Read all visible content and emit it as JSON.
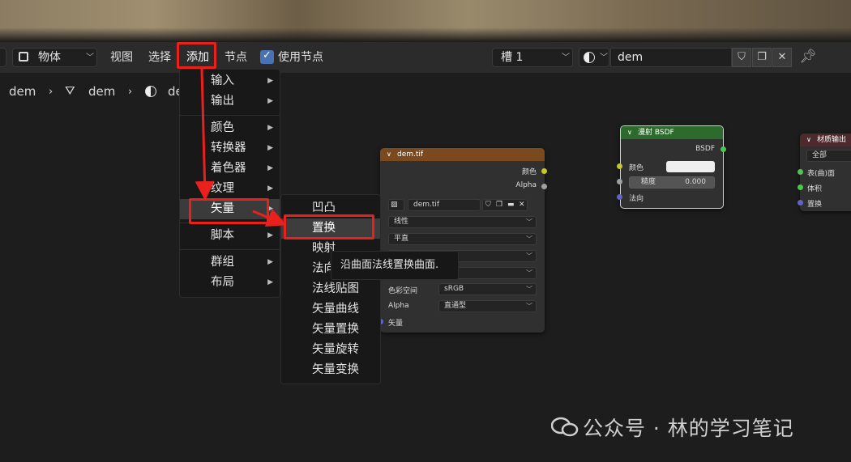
{
  "header": {
    "mode_select": "物体",
    "menus": [
      "视图",
      "选择",
      "添加",
      "节点"
    ],
    "use_nodes_label": "使用节点",
    "use_nodes_checked": true,
    "slot_select": "槽 1",
    "material_name": "dem"
  },
  "breadcrumb": [
    "dem",
    "dem",
    "dem"
  ],
  "add_menu": {
    "items": [
      {
        "label": "输入",
        "submenu": true
      },
      {
        "label": "输出",
        "submenu": true
      },
      {
        "label": "颜色",
        "submenu": true
      },
      {
        "label": "转换器",
        "submenu": true
      },
      {
        "label": "着色器",
        "submenu": true
      },
      {
        "label": "纹理",
        "submenu": true
      },
      {
        "label": "矢量",
        "submenu": true,
        "active": true
      },
      {
        "label": "脚本",
        "submenu": true
      },
      {
        "label": "群组",
        "submenu": true
      },
      {
        "label": "布局",
        "submenu": true
      }
    ]
  },
  "vector_submenu": {
    "items": [
      "凹凸",
      "置换",
      "映射",
      "法向",
      "法线贴图",
      "矢量曲线",
      "矢量置换",
      "矢量旋转",
      "矢量变换"
    ],
    "highlighted": "置换"
  },
  "tooltip": "沿曲面法线置换曲面.",
  "image_node": {
    "title": "dem.tif",
    "outputs": [
      "颜色",
      "Alpha"
    ],
    "image_name": "dem.tif",
    "interpolation": "线性",
    "projection": "平直",
    "color_space_label": "色彩空间",
    "color_space_value": "sRGB",
    "alpha_label": "Alpha",
    "alpha_value": "直通型",
    "input_vector": "矢量"
  },
  "diffuse_node": {
    "title": "漫射 BSDF",
    "output": "BSDF",
    "color_label": "颜色",
    "roughness_label": "糙度",
    "roughness_value": "0.000",
    "normal_label": "法向"
  },
  "output_node": {
    "title": "材质输出",
    "target": "全部",
    "inputs": [
      "表(曲)面",
      "体积",
      "置换"
    ]
  },
  "watermark": "公众号 · 林的学习笔记",
  "colors": {
    "annotation_red": "#e8211c",
    "image_header": "#7a4a1e",
    "shader_header": "#2d6b2d",
    "output_header": "#4d2a2e",
    "socket_yellow": "#c7c729",
    "socket_gray": "#a0a0a0",
    "socket_purple": "#6363c7",
    "socket_green": "#4cc74c"
  }
}
